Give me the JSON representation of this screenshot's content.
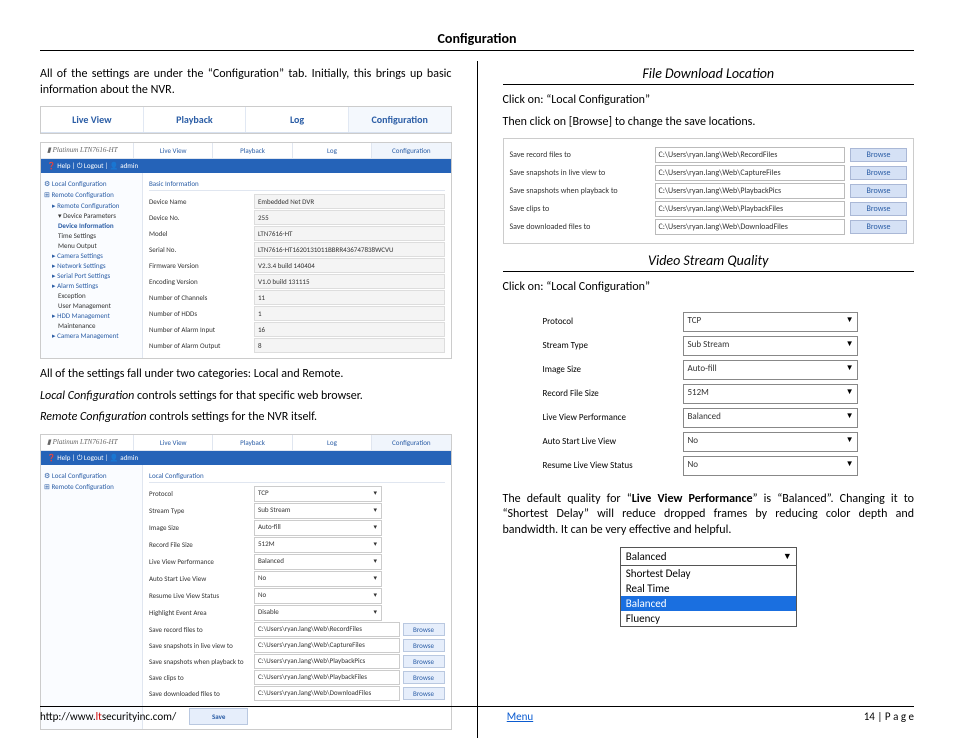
{
  "page_title": "Configuration",
  "intro_text": "All of the settings are under the “Configuration” tab.  Initially, this brings up basic information about the NVR.",
  "tabs": {
    "live": "Live View",
    "playback": "Playback",
    "log": "Log",
    "config": "Configuration"
  },
  "shot1": {
    "model": "LTN7616-HT",
    "bluebar": "❓ Help  |  ⏻ Logout  |  👤 admin",
    "side": {
      "local": "Local Configuration",
      "remote": "Remote Configuration",
      "remote2": "Remote Configuration",
      "devparam": "Device Parameters",
      "devinfo": "Device Information",
      "time": "Time Settings",
      "menu": "Menu Output",
      "cam": "Camera Settings",
      "net": "Network Settings",
      "serial": "Serial Port Settings",
      "alarm": "Alarm Settings",
      "exc": "Exception",
      "user": "User Management",
      "hdd": "HDD Management",
      "maint": "Maintenance",
      "cammgmt": "Camera Management"
    },
    "info_hdr": "Basic Information",
    "rows": {
      "devname_l": "Device Name",
      "devname_v": "Embedded Net DVR",
      "devno_l": "Device No.",
      "devno_v": "255",
      "model_l": "Model",
      "model_v": "LTN7616-HT",
      "serial_l": "Serial No.",
      "serial_v": "LTN7616-HT1620131011BBRR436747838WCVU",
      "fw_l": "Firmware Version",
      "fw_v": "V2.3.4 build 140404",
      "enc_l": "Encoding Version",
      "enc_v": "V1.0 build 131115",
      "ch_l": "Number of Channels",
      "ch_v": "11",
      "hdd_l": "Number of HDDs",
      "hdd_v": "1",
      "ai_l": "Number of Alarm Input",
      "ai_v": "16",
      "ao_l": "Number of Alarm Output",
      "ao_v": "8"
    }
  },
  "mid1": "All of the settings fall under two categories: Local and Remote.",
  "mid2a": "Local Configuration",
  "mid2b": " controls settings for that specific web browser.",
  "mid3a": "Remote Configuration",
  "mid3b": " controls settings for the NVR itself.",
  "shot2": {
    "local_hdr": "Local Configuration",
    "rows": {
      "proto_l": "Protocol",
      "proto_v": "TCP",
      "st_l": "Stream Type",
      "st_v": "Sub Stream",
      "is_l": "Image Size",
      "is_v": "Auto-fill",
      "rf_l": "Record File Size",
      "rf_v": "512M",
      "lvp_l": "Live View Performance",
      "lvp_v": "Balanced",
      "as_l": "Auto Start Live View",
      "as_v": "No",
      "rs_l": "Resume Live View Status",
      "rs_v": "No",
      "hl_l": "Highlight Event Area",
      "hl_v": "Disable"
    },
    "paths": {
      "r_l": "Save record files to",
      "r_v": "C:\\Users\\ryan.lang\\Web\\RecordFiles",
      "s1_l": "Save snapshots in live view to",
      "s1_v": "C:\\Users\\ryan.lang\\Web\\CaptureFiles",
      "s2_l": "Save snapshots when playback to",
      "s2_v": "C:\\Users\\ryan.lang\\Web\\PlaybackPics",
      "c_l": "Save clips to",
      "c_v": "C:\\Users\\ryan.lang\\Web\\PlaybackFiles",
      "d_l": "Save downloaded files to",
      "d_v": "C:\\Users\\ryan.lang\\Web\\DownloadFiles",
      "browse": "Browse"
    },
    "save": "Save"
  },
  "right": {
    "h1": "File Download Location",
    "t1": "Click on: “Local Configuration”",
    "t2": "Then click on [Browse] to change the save locations.",
    "dl": {
      "r_l": "Save record files to",
      "r_v": "C:\\Users\\ryan.lang\\Web\\RecordFiles",
      "s1_l": "Save snapshots in live view to",
      "s1_v": "C:\\Users\\ryan.lang\\Web\\CaptureFiles",
      "s2_l": "Save snapshots when playback to",
      "s2_v": "C:\\Users\\ryan.lang\\Web\\PlaybackPics",
      "c_l": "Save clips to",
      "c_v": "C:\\Users\\ryan.lang\\Web\\PlaybackFiles",
      "d_l": "Save downloaded files to",
      "d_v": "C:\\Users\\ryan.lang\\Web\\DownloadFiles",
      "browse": "Browse"
    },
    "h2": "Video Stream Quality",
    "t3": "Click on: “Local Configuration”",
    "q": {
      "proto_l": "Protocol",
      "proto_v": "TCP",
      "st_l": "Stream Type",
      "st_v": "Sub Stream",
      "is_l": "Image Size",
      "is_v": "Auto-fill",
      "rf_l": "Record File Size",
      "rf_v": "512M",
      "lvp_l": "Live View Performance",
      "lvp_v": "Balanced",
      "as_l": "Auto Start Live View",
      "as_v": "No",
      "rs_l": "Resume Live View Status",
      "rs_v": "No"
    },
    "t4a": "The default quality for “",
    "t4b": "Live View Performance",
    "t4c": "” is “Balanced”.  Changing it to “Shortest Delay” will reduce dropped frames by reducing color depth and bandwidth.  It can be very effective and helpful.",
    "drop": {
      "sel": "Balanced",
      "o1": "Shortest Delay",
      "o2": "Real Time",
      "o3": "Balanced",
      "o4": "Fluency"
    }
  },
  "footer": {
    "url_pre": "http://www.",
    "url_red": "lt",
    "url_post": "securityinc.com/",
    "menu": "Menu",
    "page": "14 | P a g e"
  }
}
